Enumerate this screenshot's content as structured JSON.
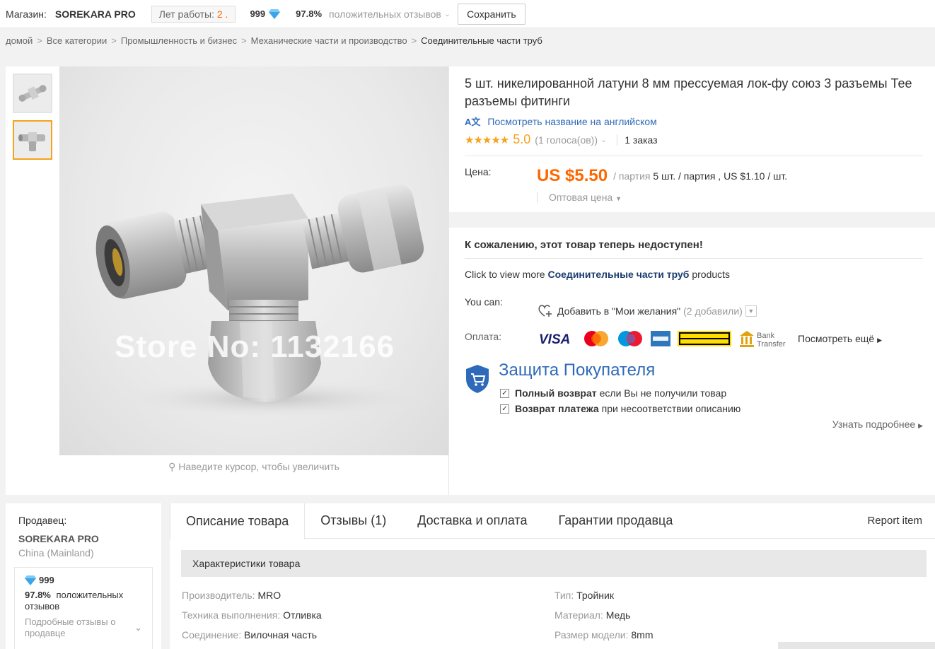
{
  "topbar": {
    "store_label": "Магазин:",
    "store_name": "SOREKARA PRO",
    "years_label": "Лет работы:",
    "years_value": "2 .",
    "score": "999",
    "positive_pct": "97.8%",
    "positive_label": "положительных отзывов",
    "save_label": "Сохранить"
  },
  "breadcrumb": [
    "домой",
    "Все категории",
    "Промышленность и бизнес",
    "Механические части и производство",
    "Соединительные части труб"
  ],
  "gallery": {
    "watermark": "Store No: 1132166",
    "zoom_hint": "Наведите курсор, чтобы увеличить"
  },
  "product": {
    "title": "5 шт. никелированной латуни 8 мм прессуемая лок-фу союз 3 разъемы Тее разъемы фитинги",
    "translate_icon": "A文",
    "translate_link": "Посмотреть название на английском",
    "stars": "★★★★★",
    "rating": "5.0",
    "votes": "(1 голоса(ов))",
    "orders": "1 заказ",
    "price_label": "Цена:",
    "price": "US $5.50",
    "price_unit_prefix": "/ партия",
    "price_unit_detail": "5 шт. / партия , US $1.10 / шт.",
    "wholesale": "Оптовая цена",
    "unavailable": "К сожалению, этот товар теперь недоступен!",
    "click_more_prefix": "Click to view more",
    "click_more_cat": "Соединительные части труб",
    "click_more_suffix": "products",
    "you_can": "You can:",
    "wishlist": "Добавить в \"Мои желания\"",
    "wishlist_count": "(2 добавили)",
    "payment_label": "Оплата:",
    "payment_more": "Посмотреть ещё",
    "payment_methods": [
      "VISA",
      "MasterCard",
      "Maestro",
      "American Express",
      "WESTERN UNION",
      "Bank Transfer"
    ]
  },
  "protection": {
    "title": "Защита Покупателя",
    "line1_bold": "Полный возврат",
    "line1_rest": "если Вы не получили товар",
    "line2_bold": "Возврат платежа",
    "line2_rest": "при несоответствии описанию",
    "more": "Узнать подробнее"
  },
  "seller": {
    "label": "Продавец:",
    "name": "SOREKARA PRO",
    "location": "China (Mainland)",
    "score": "999",
    "positive_pct": "97.8%",
    "positive_label": "положительных отзывов",
    "details": "Подробные отзывы о продавце"
  },
  "tabs": [
    "Описание товара",
    "Отзывы (1)",
    "Доставка и оплата",
    "Гарантии продавца"
  ],
  "report": "Report item",
  "specs": {
    "heading": "Характеристики товара",
    "items": [
      {
        "k": "Производитель:",
        "v": "MRO"
      },
      {
        "k": "Тип:",
        "v": "Тройник"
      },
      {
        "k": "Техника выполнения:",
        "v": "Отливка"
      },
      {
        "k": "Материал:",
        "v": "Медь"
      },
      {
        "k": "Соединение:",
        "v": "Вилочная часть"
      },
      {
        "k": "Размер модели:",
        "v": "8mm"
      }
    ]
  },
  "colors": {
    "accent": "#ff6600",
    "link": "#2e6ab9",
    "star": "#f7a21b"
  }
}
